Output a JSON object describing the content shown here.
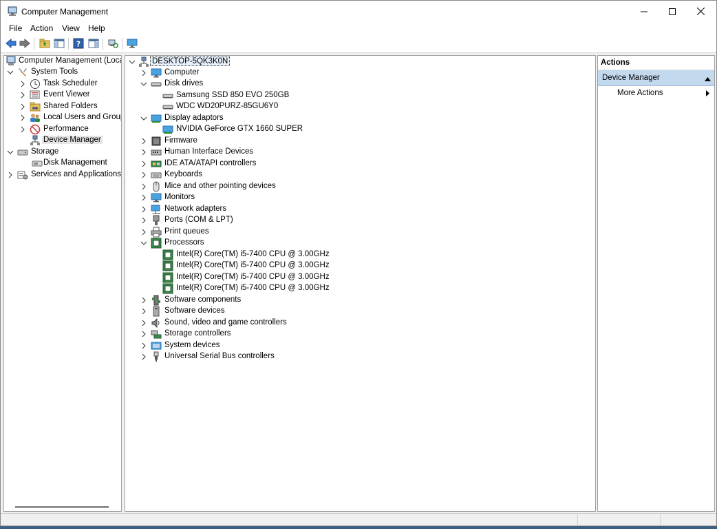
{
  "window": {
    "title": "Computer Management"
  },
  "menu": [
    "File",
    "Action",
    "View",
    "Help"
  ],
  "toolbar": {
    "buttons": [
      "back-arrow-icon",
      "forward-arrow-icon",
      "up-folder-icon",
      "show-hide-tree-icon",
      "help-icon",
      "properties-icon",
      "scan-hardware-icon",
      "monitor-icon"
    ]
  },
  "tree": {
    "root": "Computer Management (Local",
    "system_tools": "System Tools",
    "items": [
      "Task Scheduler",
      "Event Viewer",
      "Shared Folders",
      "Local Users and Groups",
      "Performance",
      "Device Manager"
    ],
    "storage": "Storage",
    "disk_management": "Disk Management",
    "services": "Services and Applications"
  },
  "devices": {
    "computer_name": "DESKTOP-5QK3K0N",
    "categories": {
      "computer": "Computer",
      "disk_drives": "Disk drives",
      "display_adaptors": "Display adaptors",
      "firmware": "Firmware",
      "hid": "Human Interface Devices",
      "ide": "IDE ATA/ATAPI controllers",
      "keyboards": "Keyboards",
      "mice": "Mice and other pointing devices",
      "monitors": "Monitors",
      "network": "Network adapters",
      "ports": "Ports (COM & LPT)",
      "print": "Print queues",
      "processors": "Processors",
      "software_components": "Software components",
      "software_devices": "Software devices",
      "sound": "Sound, video and game controllers",
      "storage_ctrl": "Storage controllers",
      "system": "System devices",
      "usb": "Universal Serial Bus controllers"
    },
    "disks": [
      "Samsung SSD 850 EVO 250GB",
      "WDC WD20PURZ-85GU6Y0"
    ],
    "gpus": [
      "NVIDIA GeForce GTX 1660 SUPER"
    ],
    "cpus": [
      "Intel(R) Core(TM) i5-7400 CPU @ 3.00GHz",
      "Intel(R) Core(TM) i5-7400 CPU @ 3.00GHz",
      "Intel(R) Core(TM) i5-7400 CPU @ 3.00GHz",
      "Intel(R) Core(TM) i5-7400 CPU @ 3.00GHz"
    ]
  },
  "actions": {
    "title": "Actions",
    "section": "Device Manager",
    "more": "More Actions"
  },
  "colors": {
    "selection": "#c3d9ee",
    "accent": "#2b6cb0"
  }
}
